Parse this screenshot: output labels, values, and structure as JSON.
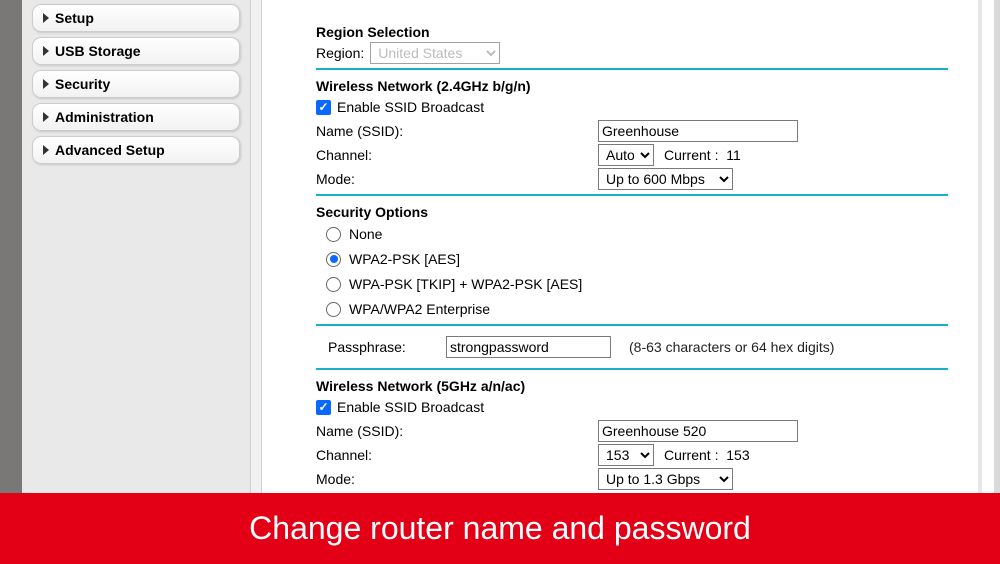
{
  "sidebar": {
    "items": [
      {
        "label": "Setup"
      },
      {
        "label": "USB Storage"
      },
      {
        "label": "Security"
      },
      {
        "label": "Administration"
      },
      {
        "label": "Advanced Setup"
      }
    ]
  },
  "region": {
    "heading": "Region Selection",
    "label": "Region:",
    "value": "United States"
  },
  "net24": {
    "heading": "Wireless Network (2.4GHz b/g/n)",
    "enable_label": "Enable SSID Broadcast",
    "enable_checked": true,
    "ssid_label": "Name (SSID):",
    "ssid_value": "Greenhouse",
    "channel_label": "Channel:",
    "channel_value": "Auto",
    "channel_current_label": "Current :",
    "channel_current": "11",
    "mode_label": "Mode:",
    "mode_value": "Up to 600 Mbps"
  },
  "security": {
    "heading": "Security Options",
    "options": [
      {
        "label": "None",
        "checked": false
      },
      {
        "label": "WPA2-PSK [AES]",
        "checked": true
      },
      {
        "label": "WPA-PSK [TKIP] + WPA2-PSK [AES]",
        "checked": false
      },
      {
        "label": "WPA/WPA2 Enterprise",
        "checked": false
      }
    ],
    "pass_label": "Passphrase:",
    "pass_value": "strongpassword",
    "pass_hint": "(8-63 characters or 64 hex digits)"
  },
  "net5": {
    "heading": "Wireless Network (5GHz a/n/ac)",
    "enable_label": "Enable SSID Broadcast",
    "enable_checked": true,
    "ssid_label": "Name (SSID):",
    "ssid_value": "Greenhouse 520",
    "channel_label": "Channel:",
    "channel_value": "153",
    "channel_current_label": "Current :",
    "channel_current": "153",
    "mode_label": "Mode:",
    "mode_value": "Up to 1.3 Gbps"
  },
  "banner": {
    "text": "Change router name and password"
  }
}
